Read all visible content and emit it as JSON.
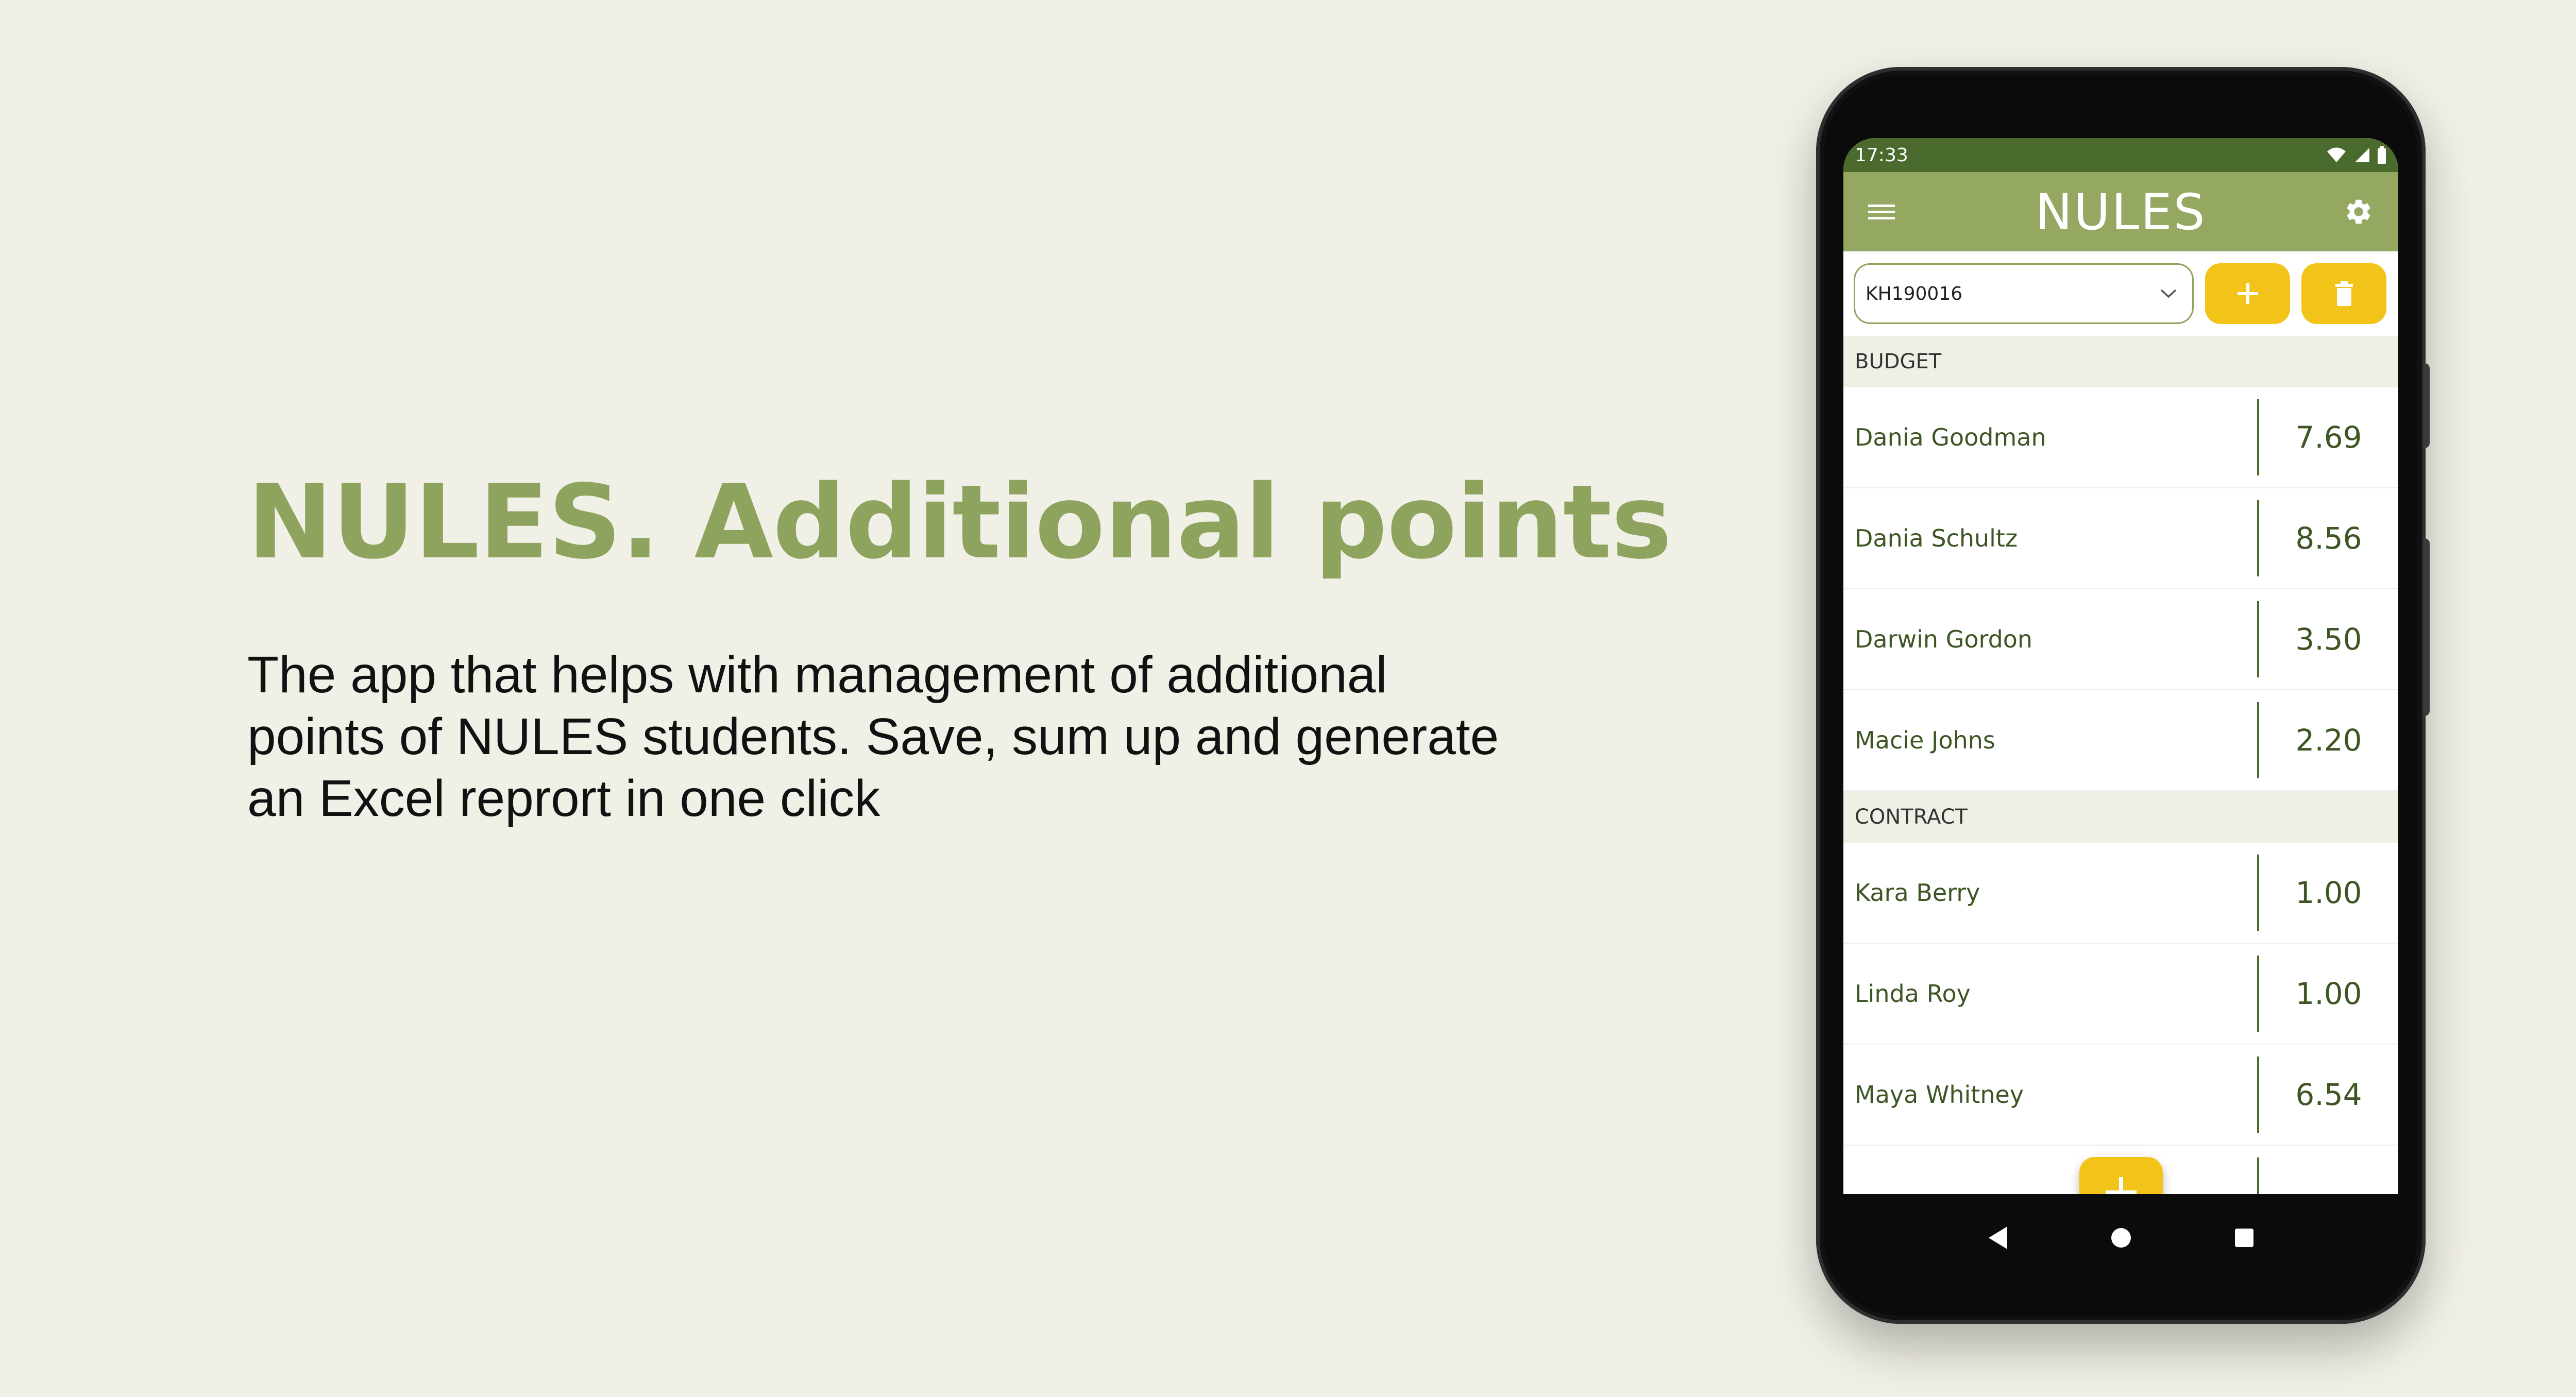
{
  "promo": {
    "headline": "NULES. Additional points",
    "tagline": "The app that helps with management of additional points of NULES students. Save, sum up and generate an Excel reprort in one click"
  },
  "status_bar": {
    "time": "17:33",
    "icons": [
      "wifi-icon",
      "signal-icon",
      "battery-icon"
    ]
  },
  "app_bar": {
    "title": "NULES",
    "menu_icon": "menu-icon",
    "settings_icon": "gear-icon"
  },
  "toolbar": {
    "group_select": "KH190016",
    "add_icon": "plus-icon",
    "delete_icon": "trash-icon"
  },
  "sections": [
    {
      "title": "BUDGET",
      "students": [
        {
          "name": "Dania Goodman",
          "points": "7.69"
        },
        {
          "name": "Dania Schultz",
          "points": "8.56"
        },
        {
          "name": "Darwin Gordon",
          "points": "3.50"
        },
        {
          "name": "Macie Johns",
          "points": "2.20"
        }
      ]
    },
    {
      "title": "CONTRACT",
      "students": [
        {
          "name": "Kara Berry",
          "points": "1.00"
        },
        {
          "name": "Linda Roy",
          "points": "1.00"
        },
        {
          "name": "Maya Whitney",
          "points": "6.54"
        }
      ]
    }
  ],
  "nav_bar": [
    "back-icon",
    "home-icon",
    "recents-icon"
  ],
  "colors": {
    "background": "#f1f0e7",
    "headline": "#8ea35e",
    "status_bar": "#4b6a2e",
    "app_bar": "#94a862",
    "accent_yellow": "#f2c41a",
    "text_green": "#3e5524"
  }
}
